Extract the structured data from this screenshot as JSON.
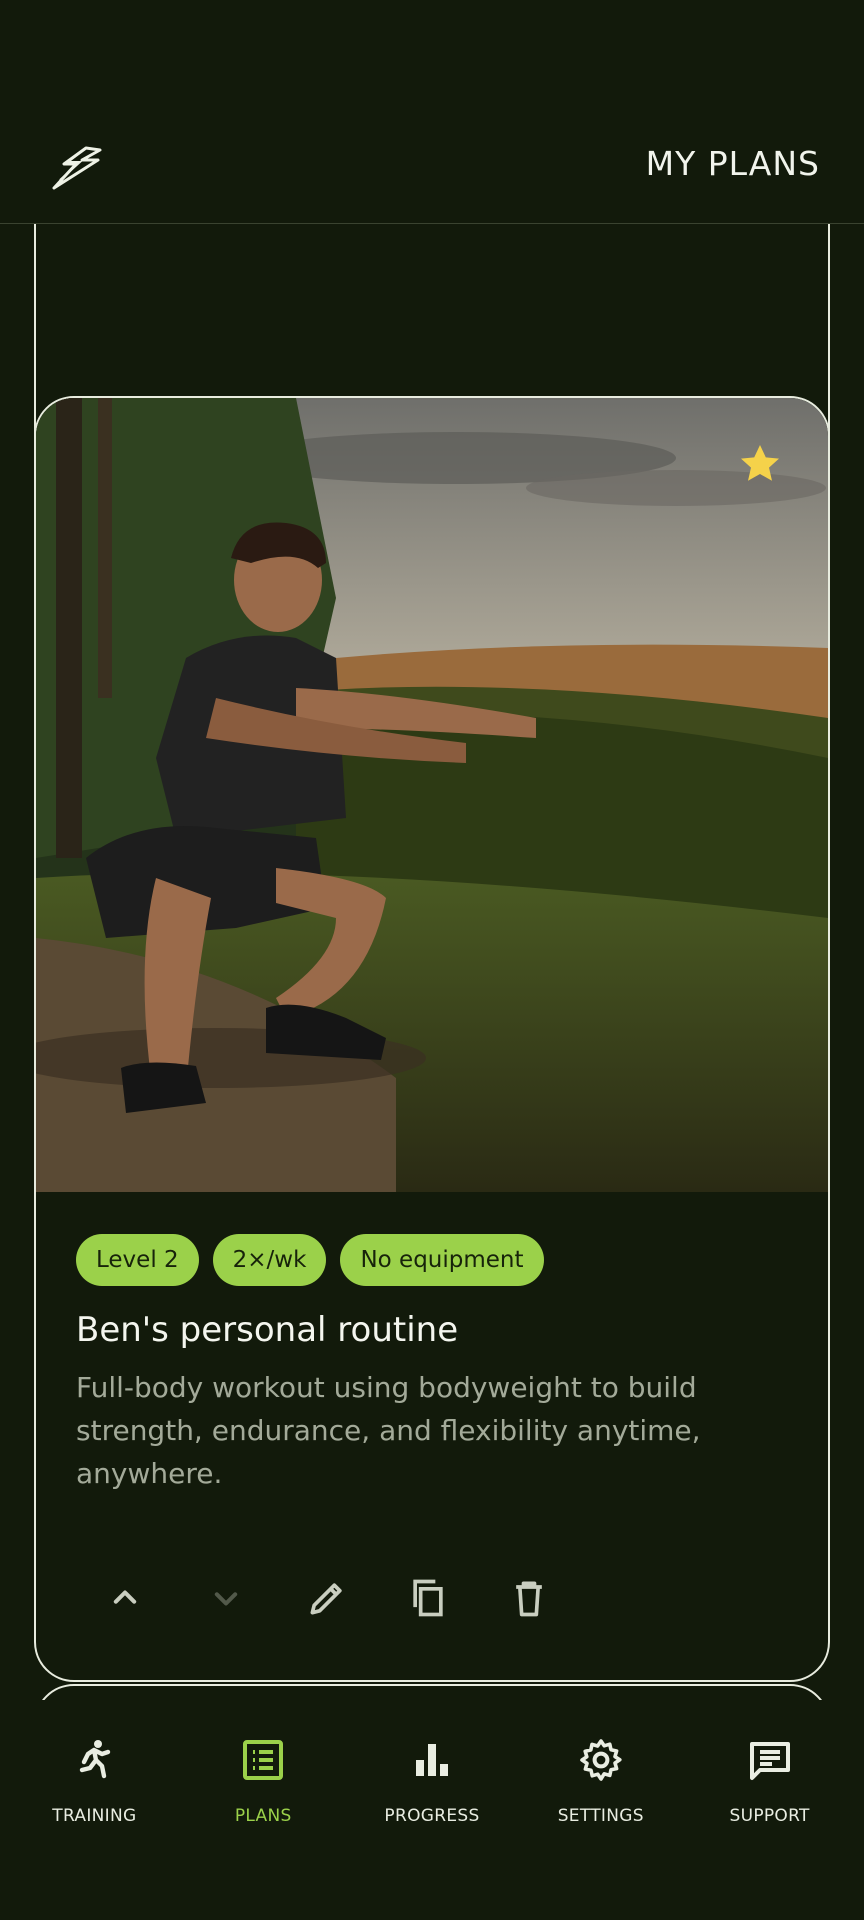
{
  "header": {
    "title": "MY PLANS",
    "logo_icon": "lightning-logo-icon"
  },
  "previous_card": {
    "actions": [
      {
        "icon": "chevron-up-icon",
        "enabled": true
      },
      {
        "icon": "chevron-down-icon",
        "enabled": true
      },
      {
        "icon": "pencil-icon",
        "enabled": true
      },
      {
        "icon": "copy-icon",
        "enabled": true
      },
      {
        "icon": "trash-icon",
        "enabled": true
      }
    ]
  },
  "plan_card": {
    "favorite": true,
    "image_alt_icon": "squat-photo",
    "chips": [
      "Level 2",
      "2×/wk",
      "No equipment"
    ],
    "title": "Ben's personal routine",
    "description": "Full-body workout using bodyweight to build strength, endurance, and flexibility anytime, anywhere.",
    "actions": [
      {
        "icon": "chevron-up-icon",
        "enabled": true
      },
      {
        "icon": "chevron-down-icon",
        "enabled": false
      },
      {
        "icon": "pencil-icon",
        "enabled": true
      },
      {
        "icon": "copy-icon",
        "enabled": true
      },
      {
        "icon": "trash-icon",
        "enabled": true
      }
    ]
  },
  "bottom_nav": {
    "items": [
      {
        "label": "TRAINING",
        "icon": "running-person-icon",
        "active": false
      },
      {
        "label": "PLANS",
        "icon": "list-icon",
        "active": true
      },
      {
        "label": "PROGRESS",
        "icon": "bar-chart-icon",
        "active": false
      },
      {
        "label": "SETTINGS",
        "icon": "gear-icon",
        "active": false
      },
      {
        "label": "SUPPORT",
        "icon": "chat-icon",
        "active": false
      }
    ]
  },
  "colors": {
    "background": "#121a0b",
    "accent": "#9bd14a",
    "star": "#f5d24a",
    "border": "#e8ecdf"
  }
}
